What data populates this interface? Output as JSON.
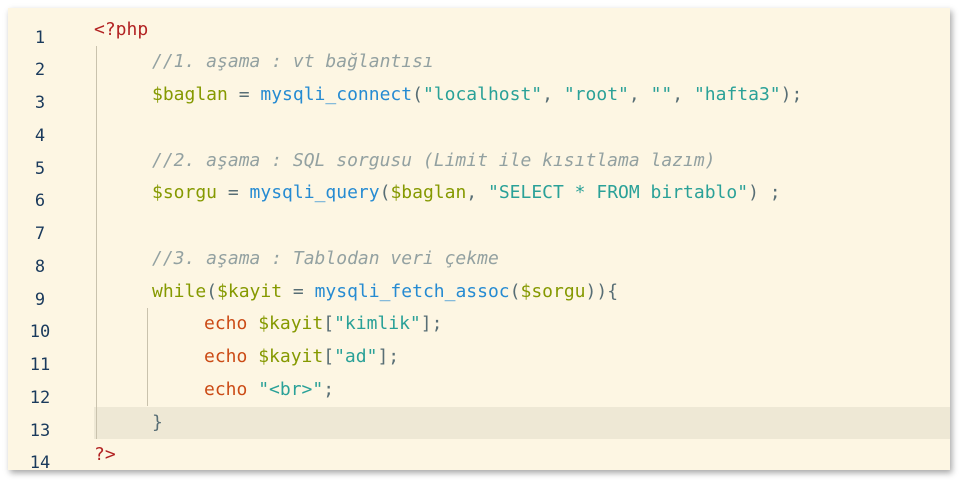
{
  "editor": {
    "line_numbers": [
      "1",
      "2",
      "3",
      "4",
      "5",
      "6",
      "7",
      "8",
      "9",
      "10",
      "11",
      "12",
      "13",
      "14"
    ],
    "active_line": 13,
    "lines": {
      "l1": {
        "open_tag": "<?php"
      },
      "l2": {
        "comment": "//1. aşama : vt bağlantısı"
      },
      "l3": {
        "var": "$baglan",
        "eq": " = ",
        "func": "mysqli_connect",
        "open": "(",
        "s1": "\"localhost\"",
        "c1": ", ",
        "s2": "\"root\"",
        "c2": ", ",
        "s3": "\"\"",
        "c3": ", ",
        "s4": "\"hafta3\"",
        "close": ");"
      },
      "l5": {
        "comment": "//2. aşama : SQL sorgusu (Limit ile kısıtlama lazım)"
      },
      "l6": {
        "var": "$sorgu",
        "eq": " = ",
        "func": "mysqli_query",
        "open": "(",
        "arg": "$baglan",
        "c1": ", ",
        "s1": "\"SELECT * FROM birtablo\"",
        "close": ") ;"
      },
      "l8": {
        "comment": "//3. aşama : Tablodan veri çekme"
      },
      "l9": {
        "kw": "while",
        "open": "(",
        "var": "$kayit",
        "eq": " = ",
        "func": "mysqli_fetch_assoc",
        "open2": "(",
        "arg": "$sorgu",
        "close": ")){"
      },
      "l10": {
        "echo": "echo",
        "sp": " ",
        "var": "$kayit",
        "open": "[",
        "s1": "\"kimlik\"",
        "close": "];"
      },
      "l11": {
        "echo": "echo",
        "sp": " ",
        "var": "$kayit",
        "open": "[",
        "s1": "\"ad\"",
        "close": "];"
      },
      "l12": {
        "echo": "echo",
        "sp": " ",
        "s1": "\"<br>\"",
        "close": ";"
      },
      "l13": {
        "brace": "}"
      },
      "l14": {
        "close_tag": "?>"
      }
    }
  }
}
